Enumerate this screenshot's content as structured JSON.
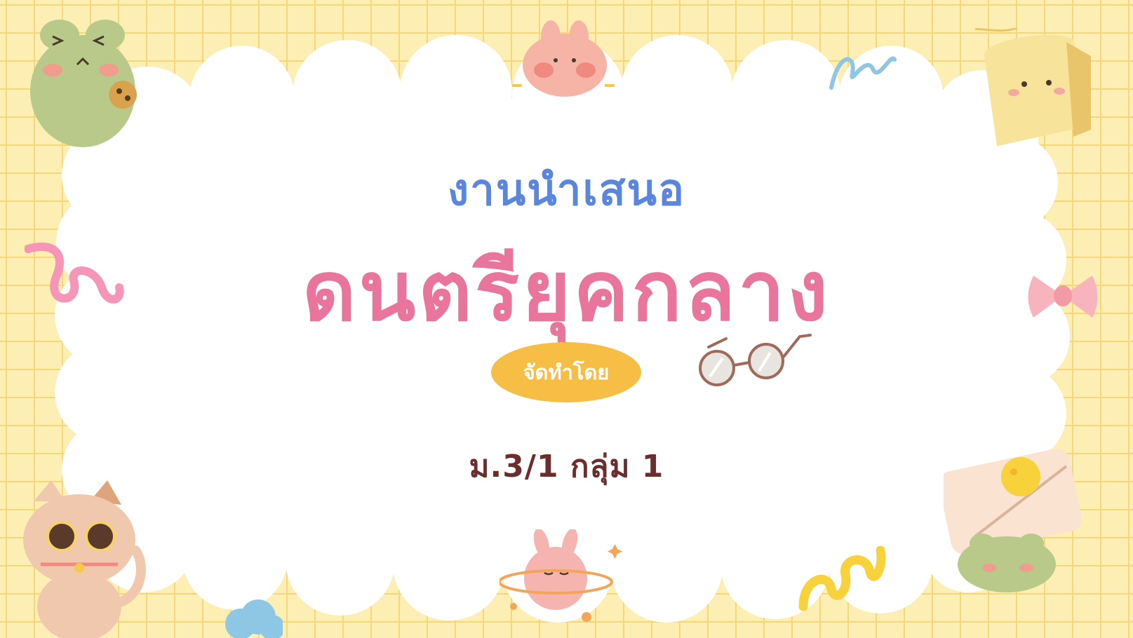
{
  "slide": {
    "subtitle": "งานนำเสนอ",
    "title": "ดนตรียุคกลาง",
    "pill_label": "จัดทำโดย",
    "group_text": "ม.3/1 กลุ่ม 1"
  },
  "colors": {
    "background": "#fdeeb4",
    "grid": "#f6d67a",
    "cloud": "#ffffff",
    "subtitle": "#5b86de",
    "title": "#e9749c",
    "pill": "#f7be46",
    "pill_text": "#ffffff",
    "group_text": "#6b2e2e"
  },
  "decorations": [
    "frog-sticker",
    "bunny-sticker",
    "toast-sticker",
    "swirl-icon",
    "bow-icon",
    "glasses-icon",
    "cat-sticker",
    "planet-bunny-sticker",
    "cloud-icon",
    "frog-cheese-sticker",
    "squiggle-icon"
  ]
}
